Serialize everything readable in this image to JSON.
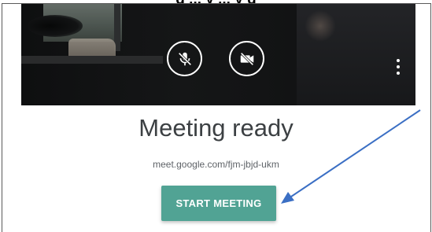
{
  "caption": {
    "text": "g ... y ... y g"
  },
  "video_preview": {
    "mic_icon": "mic-off-icon",
    "camera_icon": "videocam-off-icon",
    "more_icon": "more-vert-icon"
  },
  "meeting": {
    "title": "Meeting ready",
    "url": "meet.google.com/fjm-jbjd-ukm",
    "start_button_label": "START MEETING"
  },
  "annotation": {
    "arrow_color": "#3b6fc4"
  },
  "colors": {
    "start_button": "#51a394",
    "title_text": "#3c4043",
    "url_text": "#5f6368"
  }
}
